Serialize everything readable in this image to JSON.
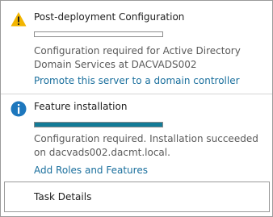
{
  "notifications": [
    {
      "icon": "warning-icon",
      "title": "Post-deployment Configuration",
      "progress": 0,
      "description": "Configuration required for Active Directory Domain Services at DACVADS002",
      "link": "Promote this server to a domain controller"
    },
    {
      "icon": "info-icon",
      "title": "Feature installation",
      "progress": 1,
      "description": "Configuration required. Installation succeeded on dacvads002.dacmt.local.",
      "link": "Add Roles and Features"
    }
  ],
  "footer": {
    "task_details_label": "Task Details"
  },
  "colors": {
    "warning": "#f2b500",
    "info": "#1d77bd",
    "progress_fill": "#137b97",
    "link": "#1a6f9d"
  }
}
